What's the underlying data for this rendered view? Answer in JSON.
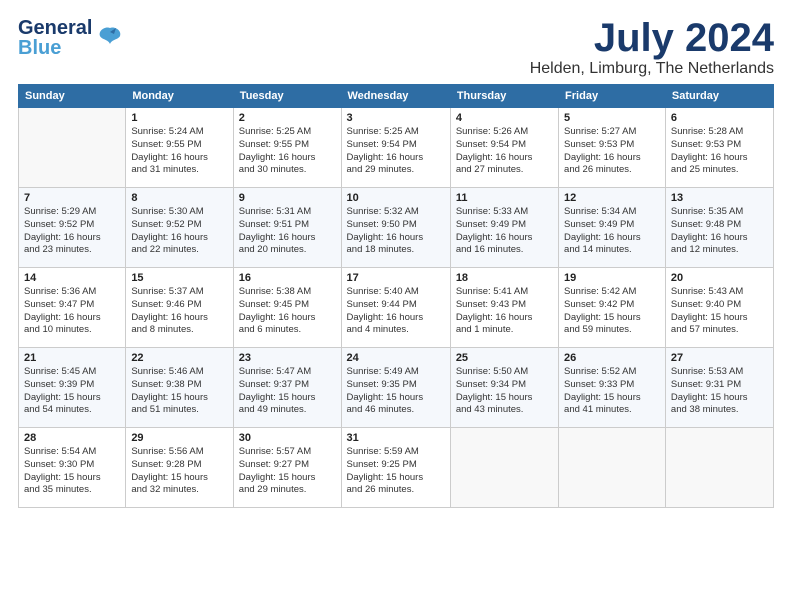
{
  "logo": {
    "general": "General",
    "blue": "Blue"
  },
  "title": "July 2024",
  "location": "Helden, Limburg, The Netherlands",
  "days_of_week": [
    "Sunday",
    "Monday",
    "Tuesday",
    "Wednesday",
    "Thursday",
    "Friday",
    "Saturday"
  ],
  "weeks": [
    [
      {
        "day": "",
        "info": ""
      },
      {
        "day": "1",
        "info": "Sunrise: 5:24 AM\nSunset: 9:55 PM\nDaylight: 16 hours\nand 31 minutes."
      },
      {
        "day": "2",
        "info": "Sunrise: 5:25 AM\nSunset: 9:55 PM\nDaylight: 16 hours\nand 30 minutes."
      },
      {
        "day": "3",
        "info": "Sunrise: 5:25 AM\nSunset: 9:54 PM\nDaylight: 16 hours\nand 29 minutes."
      },
      {
        "day": "4",
        "info": "Sunrise: 5:26 AM\nSunset: 9:54 PM\nDaylight: 16 hours\nand 27 minutes."
      },
      {
        "day": "5",
        "info": "Sunrise: 5:27 AM\nSunset: 9:53 PM\nDaylight: 16 hours\nand 26 minutes."
      },
      {
        "day": "6",
        "info": "Sunrise: 5:28 AM\nSunset: 9:53 PM\nDaylight: 16 hours\nand 25 minutes."
      }
    ],
    [
      {
        "day": "7",
        "info": "Sunrise: 5:29 AM\nSunset: 9:52 PM\nDaylight: 16 hours\nand 23 minutes."
      },
      {
        "day": "8",
        "info": "Sunrise: 5:30 AM\nSunset: 9:52 PM\nDaylight: 16 hours\nand 22 minutes."
      },
      {
        "day": "9",
        "info": "Sunrise: 5:31 AM\nSunset: 9:51 PM\nDaylight: 16 hours\nand 20 minutes."
      },
      {
        "day": "10",
        "info": "Sunrise: 5:32 AM\nSunset: 9:50 PM\nDaylight: 16 hours\nand 18 minutes."
      },
      {
        "day": "11",
        "info": "Sunrise: 5:33 AM\nSunset: 9:49 PM\nDaylight: 16 hours\nand 16 minutes."
      },
      {
        "day": "12",
        "info": "Sunrise: 5:34 AM\nSunset: 9:49 PM\nDaylight: 16 hours\nand 14 minutes."
      },
      {
        "day": "13",
        "info": "Sunrise: 5:35 AM\nSunset: 9:48 PM\nDaylight: 16 hours\nand 12 minutes."
      }
    ],
    [
      {
        "day": "14",
        "info": "Sunrise: 5:36 AM\nSunset: 9:47 PM\nDaylight: 16 hours\nand 10 minutes."
      },
      {
        "day": "15",
        "info": "Sunrise: 5:37 AM\nSunset: 9:46 PM\nDaylight: 16 hours\nand 8 minutes."
      },
      {
        "day": "16",
        "info": "Sunrise: 5:38 AM\nSunset: 9:45 PM\nDaylight: 16 hours\nand 6 minutes."
      },
      {
        "day": "17",
        "info": "Sunrise: 5:40 AM\nSunset: 9:44 PM\nDaylight: 16 hours\nand 4 minutes."
      },
      {
        "day": "18",
        "info": "Sunrise: 5:41 AM\nSunset: 9:43 PM\nDaylight: 16 hours\nand 1 minute."
      },
      {
        "day": "19",
        "info": "Sunrise: 5:42 AM\nSunset: 9:42 PM\nDaylight: 15 hours\nand 59 minutes."
      },
      {
        "day": "20",
        "info": "Sunrise: 5:43 AM\nSunset: 9:40 PM\nDaylight: 15 hours\nand 57 minutes."
      }
    ],
    [
      {
        "day": "21",
        "info": "Sunrise: 5:45 AM\nSunset: 9:39 PM\nDaylight: 15 hours\nand 54 minutes."
      },
      {
        "day": "22",
        "info": "Sunrise: 5:46 AM\nSunset: 9:38 PM\nDaylight: 15 hours\nand 51 minutes."
      },
      {
        "day": "23",
        "info": "Sunrise: 5:47 AM\nSunset: 9:37 PM\nDaylight: 15 hours\nand 49 minutes."
      },
      {
        "day": "24",
        "info": "Sunrise: 5:49 AM\nSunset: 9:35 PM\nDaylight: 15 hours\nand 46 minutes."
      },
      {
        "day": "25",
        "info": "Sunrise: 5:50 AM\nSunset: 9:34 PM\nDaylight: 15 hours\nand 43 minutes."
      },
      {
        "day": "26",
        "info": "Sunrise: 5:52 AM\nSunset: 9:33 PM\nDaylight: 15 hours\nand 41 minutes."
      },
      {
        "day": "27",
        "info": "Sunrise: 5:53 AM\nSunset: 9:31 PM\nDaylight: 15 hours\nand 38 minutes."
      }
    ],
    [
      {
        "day": "28",
        "info": "Sunrise: 5:54 AM\nSunset: 9:30 PM\nDaylight: 15 hours\nand 35 minutes."
      },
      {
        "day": "29",
        "info": "Sunrise: 5:56 AM\nSunset: 9:28 PM\nDaylight: 15 hours\nand 32 minutes."
      },
      {
        "day": "30",
        "info": "Sunrise: 5:57 AM\nSunset: 9:27 PM\nDaylight: 15 hours\nand 29 minutes."
      },
      {
        "day": "31",
        "info": "Sunrise: 5:59 AM\nSunset: 9:25 PM\nDaylight: 15 hours\nand 26 minutes."
      },
      {
        "day": "",
        "info": ""
      },
      {
        "day": "",
        "info": ""
      },
      {
        "day": "",
        "info": ""
      }
    ]
  ]
}
